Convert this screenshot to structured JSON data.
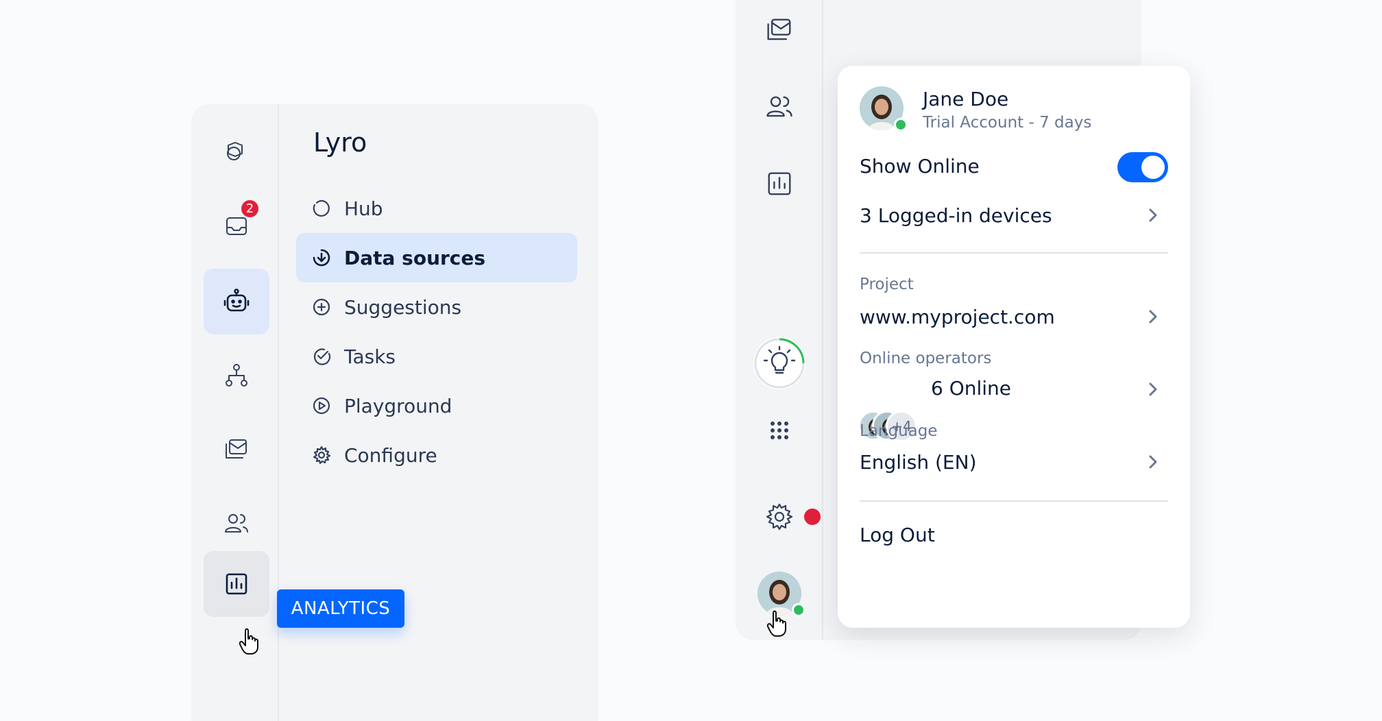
{
  "left_panel": {
    "rail": {
      "inbox_badge": "2",
      "tooltip": "ANALYTICS"
    },
    "menu": {
      "title": "Lyro",
      "items": [
        {
          "label": "Hub",
          "icon": "hub-icon"
        },
        {
          "label": "Data sources",
          "icon": "download-circle-icon"
        },
        {
          "label": "Suggestions",
          "icon": "plus-circle-icon"
        },
        {
          "label": "Tasks",
          "icon": "check-circle-icon"
        },
        {
          "label": "Playground",
          "icon": "play-circle-icon"
        },
        {
          "label": "Configure",
          "icon": "gear-icon"
        }
      ]
    }
  },
  "dropdown": {
    "user_name": "Jane Doe",
    "user_plan": "Trial Account - 7 days",
    "show_online_label": "Show Online",
    "show_online": true,
    "devices_label": "3 Logged-in devices",
    "project_label": "Project",
    "project_value": "www.myproject.com",
    "operators_label": "Online operators",
    "operators_extra": "+4",
    "operators_value": "6 Online",
    "language_label": "Language",
    "language_value": "English (EN)",
    "logout_label": "Log Out"
  },
  "colors": {
    "accent": "#0566ff",
    "badge": "#e0203b",
    "online": "#2bbd5a"
  }
}
